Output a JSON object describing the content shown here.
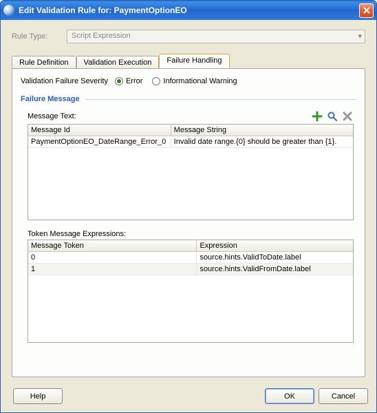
{
  "window": {
    "title": "Edit Validation Rule for: PaymentOptionEO"
  },
  "ruleType": {
    "label": "Rule Type:",
    "value": "Script Expression"
  },
  "tabs": {
    "ruleDefinition": "Rule Definition",
    "validationExecution": "Validation Execution",
    "failureHandling": "Failure Handling"
  },
  "severity": {
    "label": "Validation Failure Severity",
    "error": "Error",
    "informational": "Informational Warning"
  },
  "failureMessage": {
    "groupTitle": "Failure Message",
    "messageTextLabel": "Message Text:",
    "columns": {
      "id": "Message Id",
      "string": "Message String"
    },
    "row": {
      "id": "PaymentOptionEO_DateRange_Error_0",
      "string": "Invalid date range.{0} should be greater than {1}."
    },
    "tokenLabel": "Token Message Expressions:",
    "tokenColumns": {
      "token": "Message Token",
      "expr": "Expression"
    },
    "tokenRows": [
      {
        "token": "0",
        "expr": "source.hints.ValidToDate.label"
      },
      {
        "token": "1",
        "expr": "source.hints.ValidFromDate.label"
      }
    ]
  },
  "buttons": {
    "help": "Help",
    "ok": "OK",
    "cancel": "Cancel"
  }
}
